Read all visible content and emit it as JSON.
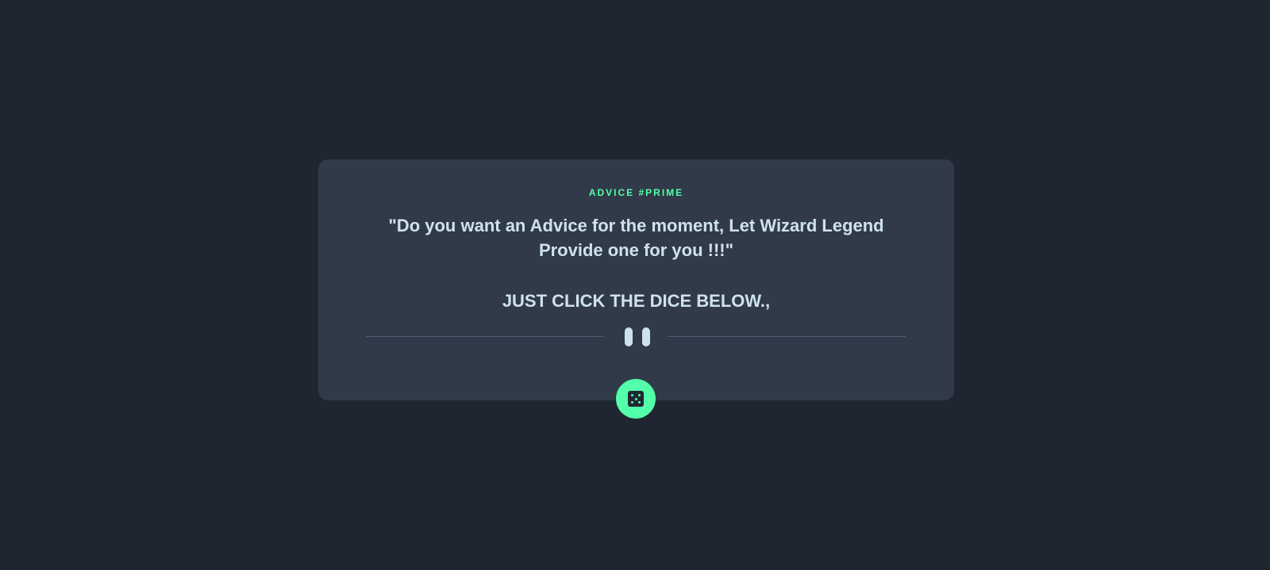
{
  "advice": {
    "id_label": "ADVICE #PRIME",
    "text": "\"Do you want an Advice for the moment, Let Wizard Legend Provide one for you !!!\"",
    "instruction": "JUST CLICK THE DICE BELOW.,"
  },
  "divider": {
    "icon": "pause-icon"
  },
  "dice_button": {
    "icon": "dice-icon"
  },
  "colors": {
    "background": "#1f2632",
    "card": "#313a49",
    "accent": "#53ffaa",
    "text": "#cee3e9",
    "divider": "#4f5d74"
  }
}
